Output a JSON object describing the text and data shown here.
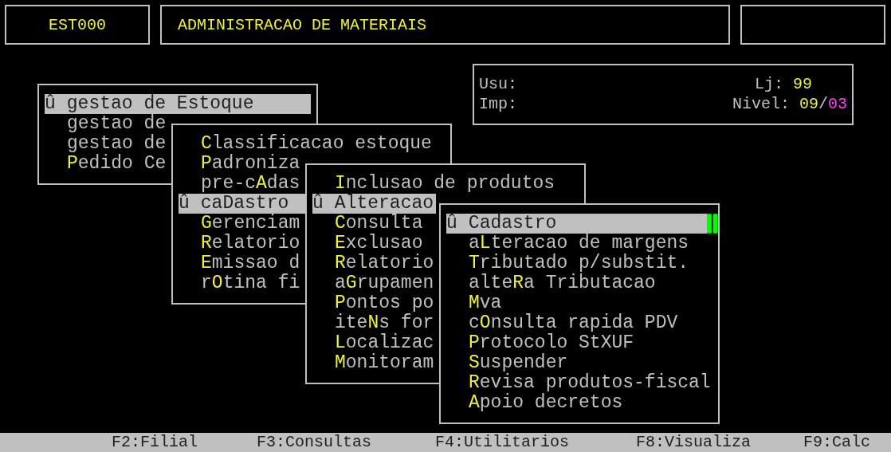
{
  "header": {
    "code": "EST000",
    "title": "ADMINISTRACAO DE MATERIAIS"
  },
  "info": {
    "user_label": "Usu:",
    "printer_label": "Imp:",
    "store_label": "Lj:",
    "store": "99",
    "level_label": "Nivel:",
    "level_a": "09",
    "separator": "/",
    "level_b": "03"
  },
  "menus": [
    {
      "active": false,
      "items": [
        {
          "selected": true,
          "prefix": "û",
          "before": "gestao de ",
          "hotkey": "E",
          "after": "stoque"
        },
        {
          "selected": false,
          "before": "gestao de"
        },
        {
          "selected": false,
          "before": "gestao de"
        },
        {
          "selected": false,
          "hotkey": "P",
          "after": "edido Ce"
        }
      ]
    },
    {
      "active": false,
      "items": [
        {
          "selected": false,
          "hotkey": "C",
          "after": "lassificacao estoque"
        },
        {
          "selected": false,
          "hotkey": "P",
          "after": "adroniza"
        },
        {
          "selected": false,
          "before": "pre-c",
          "hotkey": "A",
          "after": "das"
        },
        {
          "selected": true,
          "prefix": "û",
          "before": "ca",
          "hotkey": "D",
          "after": "astro"
        },
        {
          "selected": false,
          "hotkey": "G",
          "after": "erenciam"
        },
        {
          "selected": false,
          "hotkey": "R",
          "after": "elatorio"
        },
        {
          "selected": false,
          "hotkey": "E",
          "after": "missao d"
        },
        {
          "selected": false,
          "before": "r",
          "hotkey": "O",
          "after": "tina fi"
        }
      ]
    },
    {
      "active": false,
      "items": [
        {
          "selected": false,
          "hotkey": "I",
          "after": "nclusao de produtos"
        },
        {
          "selected": true,
          "prefix": "û",
          "hotkey": "A",
          "after": "lteracao"
        },
        {
          "selected": false,
          "hotkey": "C",
          "after": "onsulta"
        },
        {
          "selected": false,
          "hotkey": "E",
          "after": "xclusao"
        },
        {
          "selected": false,
          "hotkey": "R",
          "after": "elatorio"
        },
        {
          "selected": false,
          "before": "a",
          "hotkey": "G",
          "after": "rupamen"
        },
        {
          "selected": false,
          "hotkey": "P",
          "after": "ontos po"
        },
        {
          "selected": false,
          "before": "ite",
          "hotkey": "N",
          "after": "s for"
        },
        {
          "selected": false,
          "hotkey": "L",
          "after": "ocalizac"
        },
        {
          "selected": false,
          "hotkey": "M",
          "after": "onitoram"
        }
      ]
    },
    {
      "active": true,
      "items": [
        {
          "selected": true,
          "prefix": "û",
          "hotkey": "C",
          "after": "adastro"
        },
        {
          "selected": false,
          "before": "a",
          "hotkey": "L",
          "after": "teracao de margens"
        },
        {
          "selected": false,
          "hotkey": "T",
          "after": "ributado p/substit."
        },
        {
          "selected": false,
          "before": "alte",
          "hotkey": "R",
          "after": "a Tributacao"
        },
        {
          "selected": false,
          "hotkey": "M",
          "after": "va"
        },
        {
          "selected": false,
          "before": "c",
          "hotkey": "O",
          "after": "nsulta rapida PDV"
        },
        {
          "selected": false,
          "hotkey": "P",
          "after": "rotocolo StXUF"
        },
        {
          "selected": false,
          "hotkey": "S",
          "after": "uspender"
        },
        {
          "selected": false,
          "hotkey": "R",
          "after": "evisa produtos-fiscal"
        },
        {
          "selected": false,
          "hotkey": "A",
          "after": "poio decretos"
        }
      ]
    }
  ],
  "function_keys": [
    "F2:Filial",
    "F3:Consultas",
    "F4:Utilitarios",
    "F8:Visualiza",
    "F9:Calc"
  ]
}
